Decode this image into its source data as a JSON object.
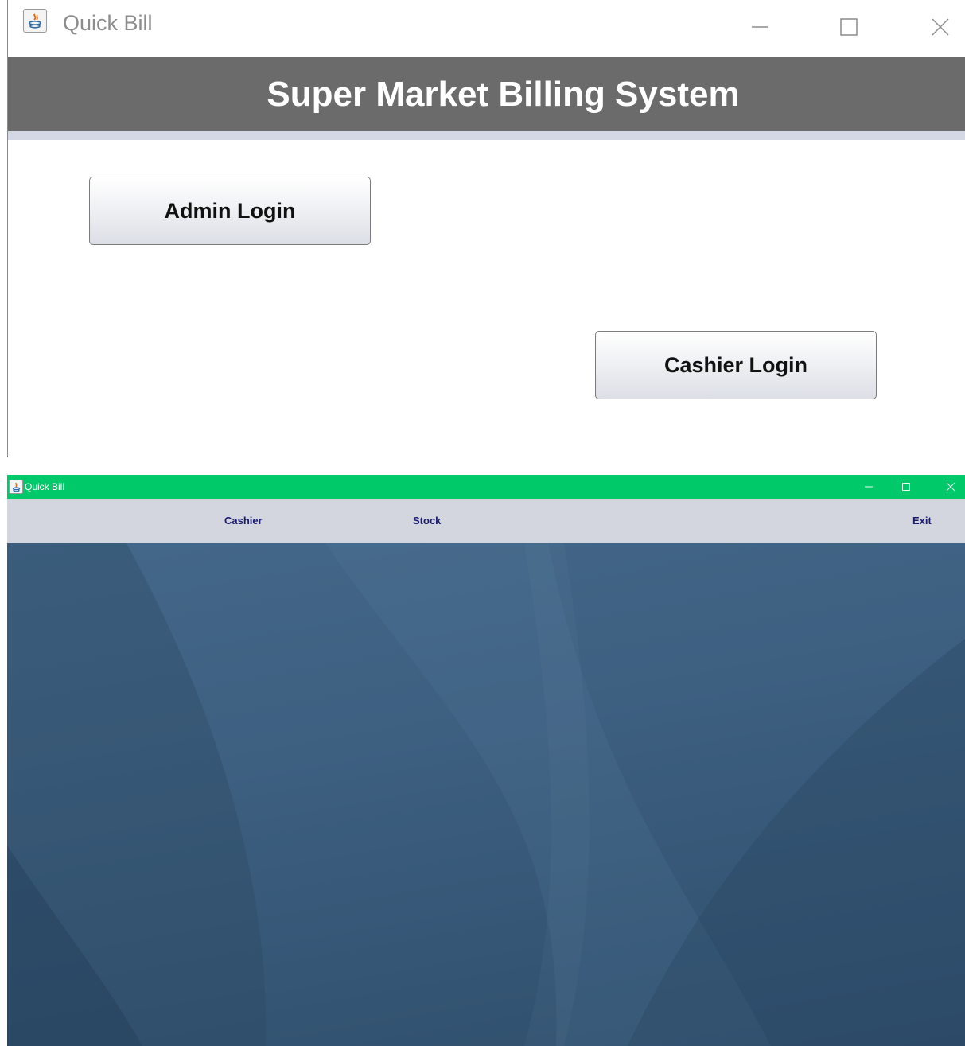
{
  "login_window": {
    "title": "Quick Bill",
    "banner": "Super Market Billing System",
    "admin_button": "Admin Login",
    "cashier_button": "Cashier Login",
    "colors": {
      "banner_bg": "#6b6b6b",
      "banner_strip": "#d4d8e4"
    }
  },
  "main_window": {
    "title": "Quick Bill",
    "menu": {
      "cashier": "Cashier",
      "stock": "Stock",
      "exit": "Exit"
    },
    "colors": {
      "titlebar_bg": "#00c96a",
      "menubar_bg": "#d3d6df",
      "menu_text": "#1b1b6e",
      "desktop_bg": "#3d5f80"
    }
  }
}
